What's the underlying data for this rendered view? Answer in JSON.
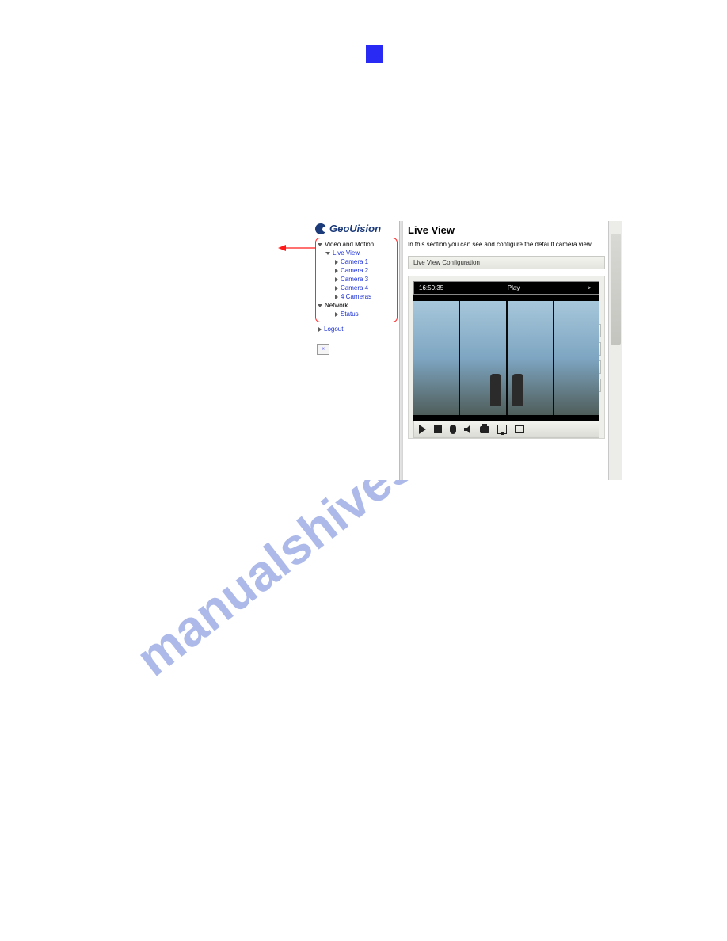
{
  "decor": {
    "watermark": "manualshives.com"
  },
  "app": {
    "brand": "GeoUision",
    "collapse_glyph": "«"
  },
  "tree": {
    "root1": "Video and Motion",
    "live_view": "Live View",
    "cams": [
      "Camera 1",
      "Camera 2",
      "Camera 3",
      "Camera 4",
      "4 Cameras"
    ],
    "root2": "Network",
    "status": "Status",
    "logout": "Logout"
  },
  "panel": {
    "title": "Live View",
    "desc": "In this section you can see and configure the default camera view.",
    "section": "Live View Configuration",
    "timestamp": "16:50:35",
    "state": "Play",
    "next": ">"
  },
  "side_icons": [
    "list-icon",
    "camera-icon",
    "ptz-icon",
    "io-icon"
  ],
  "toolbar_icons": [
    "play-icon",
    "stop-icon",
    "mic-icon",
    "speaker-icon",
    "snapshot-icon",
    "save-icon",
    "fullscreen-icon"
  ]
}
